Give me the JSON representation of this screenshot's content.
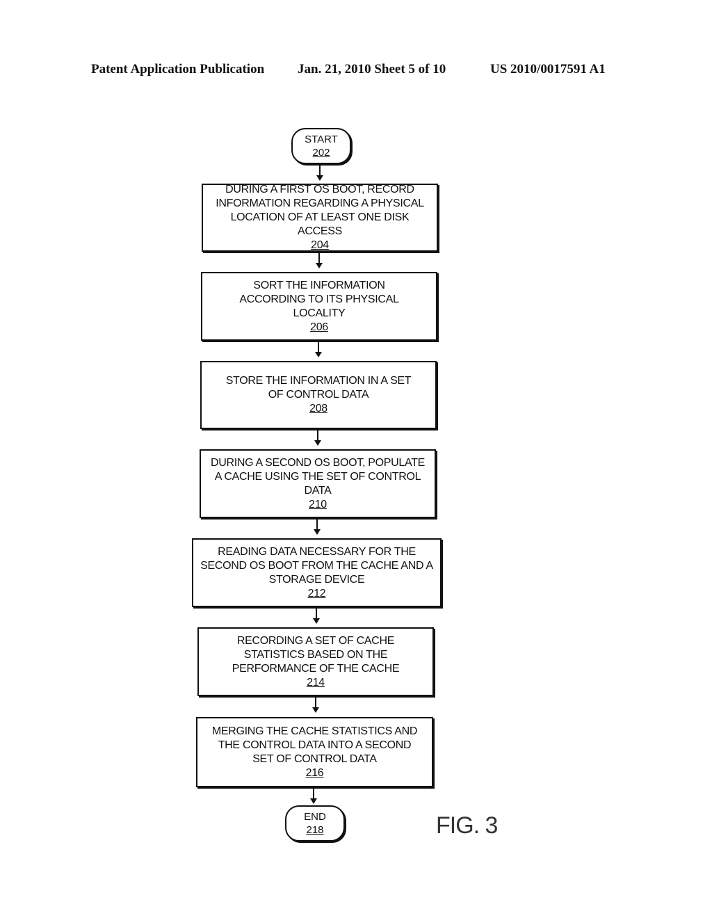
{
  "header": {
    "left": "Patent Application Publication",
    "middle": "Jan. 21, 2010  Sheet 5 of 10",
    "right": "US 2010/0017591 A1"
  },
  "flowchart": {
    "start": {
      "label": "START",
      "ref": "202"
    },
    "steps": [
      {
        "text": "DURING A FIRST OS BOOT, RECORD INFORMATION REGARDING A PHYSICAL LOCATION OF AT LEAST ONE DISK ACCESS",
        "ref": "204"
      },
      {
        "text": "SORT THE INFORMATION ACCORDING TO ITS PHYSICAL LOCALITY",
        "ref": "206"
      },
      {
        "text": "STORE THE INFORMATION IN A SET OF CONTROL DATA",
        "ref": "208"
      },
      {
        "text": "DURING A SECOND OS BOOT, POPULATE A CACHE USING THE SET OF CONTROL DATA",
        "ref": "210"
      },
      {
        "text": "READING DATA NECESSARY FOR THE SECOND OS BOOT FROM THE CACHE AND A STORAGE DEVICE",
        "ref": "212"
      },
      {
        "text": "RECORDING A SET OF CACHE STATISTICS BASED ON THE PERFORMANCE OF THE CACHE",
        "ref": "214"
      },
      {
        "text": "MERGING THE CACHE STATISTICS AND THE CONTROL DATA INTO A SECOND SET OF CONTROL DATA",
        "ref": "216"
      }
    ],
    "end": {
      "label": "END",
      "ref": "218"
    }
  },
  "figure_label": "FIG. 3"
}
